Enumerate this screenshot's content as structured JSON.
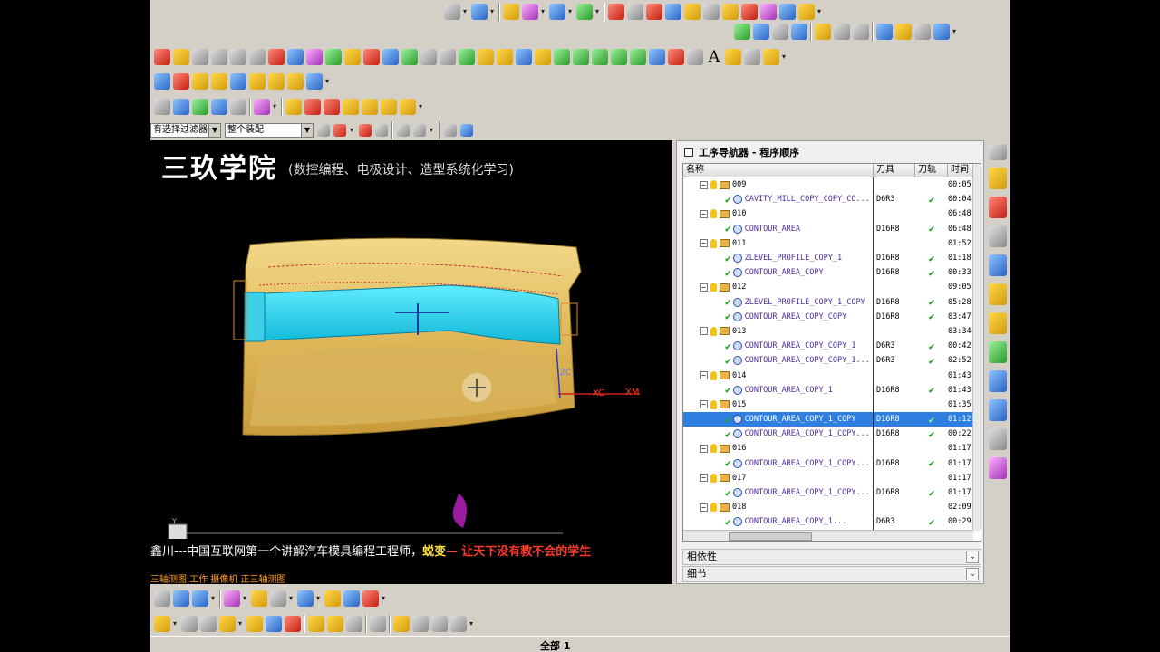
{
  "toolbars": {
    "row1_icons": [
      "surface-icon",
      "cursor-icon",
      "arrow-icon",
      "axis-icon",
      "ruler-icon",
      "pmi-icon",
      "sheet-icon",
      "flag-icon",
      "layer-icon",
      "box-icon",
      "tiger-icon",
      "print-icon",
      "arrow-down-icon",
      "pin-icon",
      "pencil-icon",
      "arrow-icon",
      "circle-icon",
      "flag-icon"
    ],
    "row2_icons": [
      "check-icon",
      "tree-icon",
      "gear-icon",
      "layers-icon",
      "flag-icon",
      "monitor-icon",
      "doc-icon",
      "copy-icon",
      "arrow-icon",
      "swap-icon",
      "gear-icon"
    ],
    "text_tool": "A"
  },
  "filter": {
    "selection_filter": "有选择过滤器",
    "assembly_scope": "整个装配"
  },
  "viewport": {
    "watermark_title": "三玖学院",
    "watermark_subtitle": "(数控编程、电极设计、造型系统化学习)",
    "axis_xc": "XC",
    "axis_xm": "XM",
    "axis_zc": "ZC",
    "triad_y": "Y",
    "banner_prefix": "鑫川---中国互联网第一个讲解汽车模具编程工程师，",
    "banner_highlight": "蜕变",
    "banner_dash": "—",
    "banner_slogan": "让天下没有教不会的学生",
    "view_mode": "三轴测图 工作 摄像机 正三轴测图"
  },
  "navigator": {
    "title": "工序导航器 - 程序顺序",
    "columns": [
      "名称",
      "刀具",
      "刀轨",
      "时间"
    ],
    "rows": [
      {
        "type": "group",
        "name": "009",
        "tool": "",
        "path": "",
        "time": "00:05"
      },
      {
        "type": "op",
        "name": "CAVITY_MILL_COPY_COPY_CO...",
        "tool": "D6R3",
        "path": "✔",
        "time": "00:04"
      },
      {
        "type": "group",
        "name": "010",
        "tool": "",
        "path": "",
        "time": "06:48"
      },
      {
        "type": "op",
        "name": "CONTOUR_AREA",
        "tool": "D16R8",
        "path": "✔",
        "time": "06:48"
      },
      {
        "type": "group",
        "name": "011",
        "tool": "",
        "path": "",
        "time": "01:52"
      },
      {
        "type": "op",
        "name": "ZLEVEL_PROFILE_COPY_1",
        "tool": "D16R8",
        "path": "✔",
        "time": "01:18"
      },
      {
        "type": "op",
        "name": "CONTOUR_AREA_COPY",
        "tool": "D16R8",
        "path": "✔",
        "time": "00:33"
      },
      {
        "type": "group",
        "name": "012",
        "tool": "",
        "path": "",
        "time": "09:05"
      },
      {
        "type": "op",
        "name": "ZLEVEL_PROFILE_COPY_1_COPY",
        "tool": "D16R8",
        "path": "✔",
        "time": "05:28"
      },
      {
        "type": "op",
        "name": "CONTOUR_AREA_COPY_COPY",
        "tool": "D16R8",
        "path": "✔",
        "time": "03:47"
      },
      {
        "type": "group",
        "name": "013",
        "tool": "",
        "path": "",
        "time": "03:34"
      },
      {
        "type": "op",
        "name": "CONTOUR_AREA_COPY_COPY_1",
        "tool": "D6R3",
        "path": "✔",
        "time": "00:42"
      },
      {
        "type": "op",
        "name": "CONTOUR_AREA_COPY_COPY_1...",
        "tool": "D6R3",
        "path": "✔",
        "time": "02:52"
      },
      {
        "type": "group",
        "name": "014",
        "tool": "",
        "path": "",
        "time": "01:43"
      },
      {
        "type": "op",
        "name": "CONTOUR_AREA_COPY_1",
        "tool": "D16R8",
        "path": "✔",
        "time": "01:43"
      },
      {
        "type": "group",
        "name": "015",
        "tool": "",
        "path": "",
        "time": "01:35"
      },
      {
        "type": "op",
        "name": "CONTOUR_AREA_COPY_1_COPY",
        "tool": "D16R8",
        "path": "✔",
        "time": "01:12",
        "selected": true
      },
      {
        "type": "op",
        "name": "CONTOUR_AREA_COPY_1_COPY...",
        "tool": "D16R8",
        "path": "✔",
        "time": "00:22"
      },
      {
        "type": "group",
        "name": "016",
        "tool": "",
        "path": "",
        "time": "01:17"
      },
      {
        "type": "op",
        "name": "CONTOUR_AREA_COPY_1_COPY...",
        "tool": "D16R8",
        "path": "✔",
        "time": "01:17"
      },
      {
        "type": "group",
        "name": "017",
        "tool": "",
        "path": "",
        "time": "01:17"
      },
      {
        "type": "op",
        "name": "CONTOUR_AREA_COPY_1_COPY...",
        "tool": "D16R8",
        "path": "✔",
        "time": "01:17"
      },
      {
        "type": "group",
        "name": "018",
        "tool": "",
        "path": "",
        "time": "02:09"
      },
      {
        "type": "op",
        "name": "CONTOUR_AREA_COPY_1...",
        "tool": "D6R3",
        "path": "✔",
        "time": "00:29"
      }
    ],
    "sections": [
      "相依性",
      "细节"
    ]
  },
  "status": {
    "all_label": "全部",
    "count": "1"
  },
  "colors": {
    "selected_row": "#2f7fe0",
    "check_green": "#1aa01a",
    "part_gold": "#e8c86a",
    "part_cyan": "#20d8f0"
  }
}
